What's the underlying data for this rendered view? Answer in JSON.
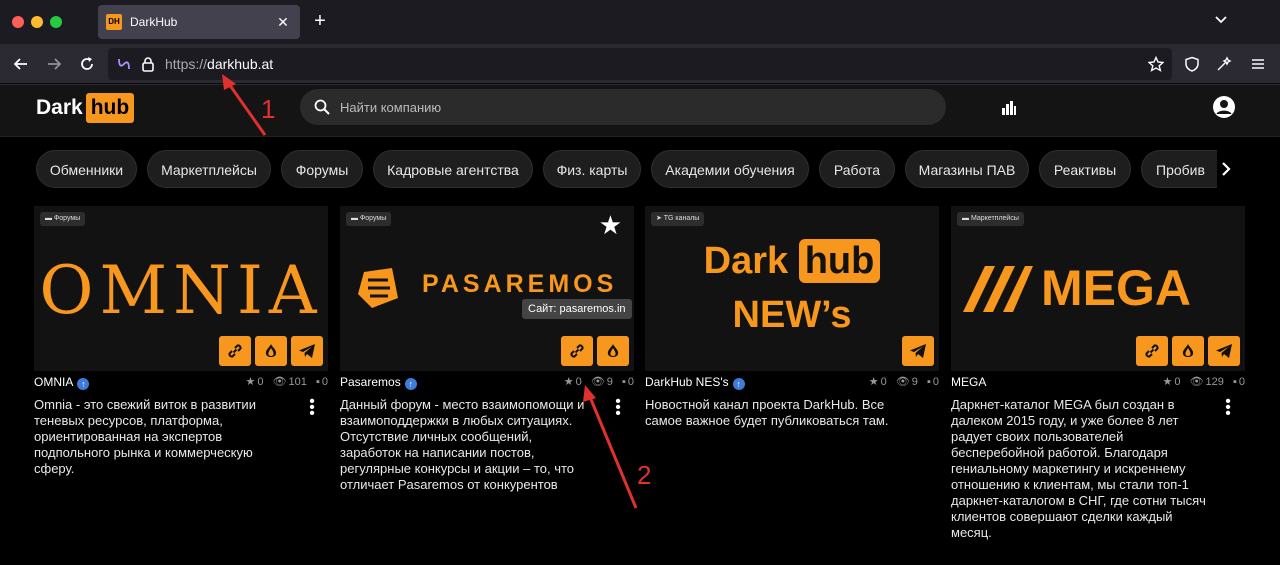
{
  "browser": {
    "tab_title": "DarkHub",
    "tab_favicon_text": "DH",
    "url_proto": "https://",
    "url_host": "darkhub.at"
  },
  "site": {
    "logo_dark": "Dark",
    "logo_hub": "hub",
    "search_placeholder": "Найти компанию",
    "accent_color": "#f7971d"
  },
  "categories": [
    "Обменники",
    "Маркетплейсы",
    "Форумы",
    "Кадровые агентства",
    "Физ. карты",
    "Академии обучения",
    "Работа",
    "Магазины ПАВ",
    "Реактивы",
    "Пробив"
  ],
  "cards": [
    {
      "category": "Форумы",
      "banner_text": "OMNIA",
      "name": "OMNIA",
      "stars": "0",
      "views": "101",
      "comments": "0",
      "description": "Omnia - это свежий виток в развитии теневых ресурсов, платформа, ориентированная на экспертов подпольного рынка и коммерческую сферу.",
      "actions": [
        "link-icon",
        "onion-icon",
        "telegram-icon"
      ]
    },
    {
      "category": "Форумы",
      "banner_text": "PASAREMOS",
      "name": "Pasaremos",
      "stars": "0",
      "views": "9",
      "comments": "0",
      "tooltip": "Сайт: pasaremos.in",
      "description": "Данный форум - место взаимопомощи и взаимоподдержки в любых ситуациях. Отсутствие личных сообщений, заработок на написании постов, регулярные конкурсы и акции – то, что отличает Pasaremos от конкурентов",
      "actions": [
        "link-icon",
        "onion-icon"
      ]
    },
    {
      "category": "TG каналы",
      "banner_dark": "Dark",
      "banner_hub": "hub",
      "banner_news": "NEW’s",
      "name": "DarkHub NES's",
      "stars": "0",
      "views": "9",
      "comments": "0",
      "description": "Новостной канал проекта DarkHub. Все самое важное будет публиковаться там.",
      "actions": [
        "telegram-icon"
      ]
    },
    {
      "category": "Маркетплейсы",
      "banner_text": "MEGA",
      "name": "MEGA",
      "stars": "0",
      "views": "129",
      "comments": "0",
      "description": "Даркнет-каталог MEGA был создан в далеком 2015 году, и уже более 8 лет радует своих пользователей бесперебойной работой. Благодаря гениальному маркетингу и искреннему отношению к клиентам, мы стали топ-1 даркнет-каталогом в СНГ, где сотни тысяч клиентов совершают сделки каждый месяц.",
      "actions": [
        "link-icon",
        "onion-icon",
        "telegram-icon"
      ]
    }
  ],
  "annotations": [
    "1",
    "2"
  ]
}
